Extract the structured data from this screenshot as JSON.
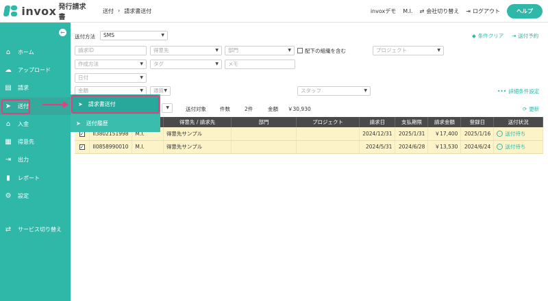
{
  "app": {
    "logo_text": "invox",
    "logo_sub": "発行請求書"
  },
  "breadcrumb": {
    "parent": "送付",
    "separator": "›",
    "current": "請求書送付"
  },
  "header": {
    "tenant": "invoxデモ",
    "user": "M.I.",
    "switch_company": "会社切り替え",
    "logout": "ログアウト",
    "help": "ヘルプ"
  },
  "sidebar": {
    "items": [
      {
        "label": "ホーム",
        "icon": "home-icon",
        "glyph": "⌂"
      },
      {
        "label": "アップロード",
        "icon": "cloud-upload-icon",
        "glyph": "☁"
      },
      {
        "label": "請求",
        "icon": "document-icon",
        "glyph": "▤"
      },
      {
        "label": "送付",
        "icon": "paper-plane-icon",
        "glyph": "➤"
      },
      {
        "label": "入金",
        "icon": "bank-icon",
        "glyph": "⌂"
      },
      {
        "label": "得意先",
        "icon": "building-icon",
        "glyph": "▦"
      },
      {
        "label": "出力",
        "icon": "export-icon",
        "glyph": "⇥"
      },
      {
        "label": "レポート",
        "icon": "chart-icon",
        "glyph": "▮"
      },
      {
        "label": "設定",
        "icon": "gear-icon",
        "glyph": "⚙"
      }
    ],
    "service_switch": "サービス切り替え"
  },
  "flyout": {
    "items": [
      {
        "label": "請求書送付"
      },
      {
        "label": "送付履歴"
      }
    ]
  },
  "filters": {
    "send_method_label": "送付方法",
    "send_method_value": "SMS",
    "condition_clear": "条件クリア",
    "scheduled_send": "送付予約",
    "invoice_id_placeholder": "請求ID",
    "customer_placeholder": "得意先",
    "department_placeholder": "部門",
    "include_sub_orgs": "配下の組織を含む",
    "project_placeholder": "プロジェクト",
    "creation_method_placeholder": "作成方法",
    "tag_placeholder": "タグ",
    "memo_placeholder": "メモ",
    "date_placeholder": "日付",
    "amount_placeholder": "金額",
    "currency_placeholder": "通貨",
    "staff_placeholder": "スタッフ",
    "advanced_settings": "詳細条件設定"
  },
  "summary": {
    "target_label": "送付対象",
    "count_label": "件数",
    "count_value": "2件",
    "amount_label": "金額",
    "amount_value": "￥30,930",
    "refresh": "更新"
  },
  "table": {
    "headers": [
      "",
      "",
      "",
      "得意先 / 請求先",
      "部門",
      "プロジェクト",
      "請求日",
      "支払期限",
      "請求金額",
      "登録日",
      "送付状況"
    ],
    "rows": [
      {
        "id": "II3802151998",
        "staff": "M.I.",
        "customer": "得意先サンプル",
        "department": "",
        "project": "",
        "invoice_date": "2024/12/31",
        "due_date": "2025/1/31",
        "amount": "￥17,400",
        "registered": "2025/1/16",
        "status": "送付待ち"
      },
      {
        "id": "II0858990010",
        "staff": "M.I.",
        "customer": "得意先サンプル",
        "department": "",
        "project": "",
        "invoice_date": "2024/5/31",
        "due_date": "2024/6/28",
        "amount": "￥13,530",
        "registered": "2024/6/24",
        "status": "送付待ち"
      }
    ]
  },
  "colors": {
    "brand": "#2fb7a8",
    "highlight": "#e0417a",
    "table_header": "#4a4a4a",
    "row_bg": "#fdf3c9"
  }
}
